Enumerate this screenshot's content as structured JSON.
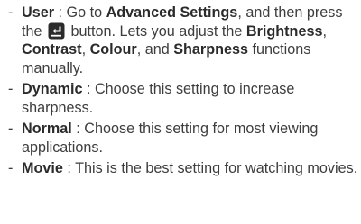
{
  "items": [
    {
      "dash": "-",
      "term": "User",
      "parts": [
        " : Go to ",
        "Advanced Settings",
        ", and then press the ",
        " button. Lets you adjust the ",
        "Brightness",
        ", ",
        "Contrast",
        ", ",
        "Colour",
        ", and ",
        "Sharpness",
        " functions manually."
      ],
      "button_icon": "enter-button-icon"
    },
    {
      "dash": "-",
      "term": "Dynamic",
      "text": " : Choose this setting to increase sharpness."
    },
    {
      "dash": "-",
      "term": "Normal",
      "text": " : Choose this setting for most viewing applications."
    },
    {
      "dash": "-",
      "term": "Movie",
      "text": " : This is the best setting for watching movies."
    }
  ]
}
